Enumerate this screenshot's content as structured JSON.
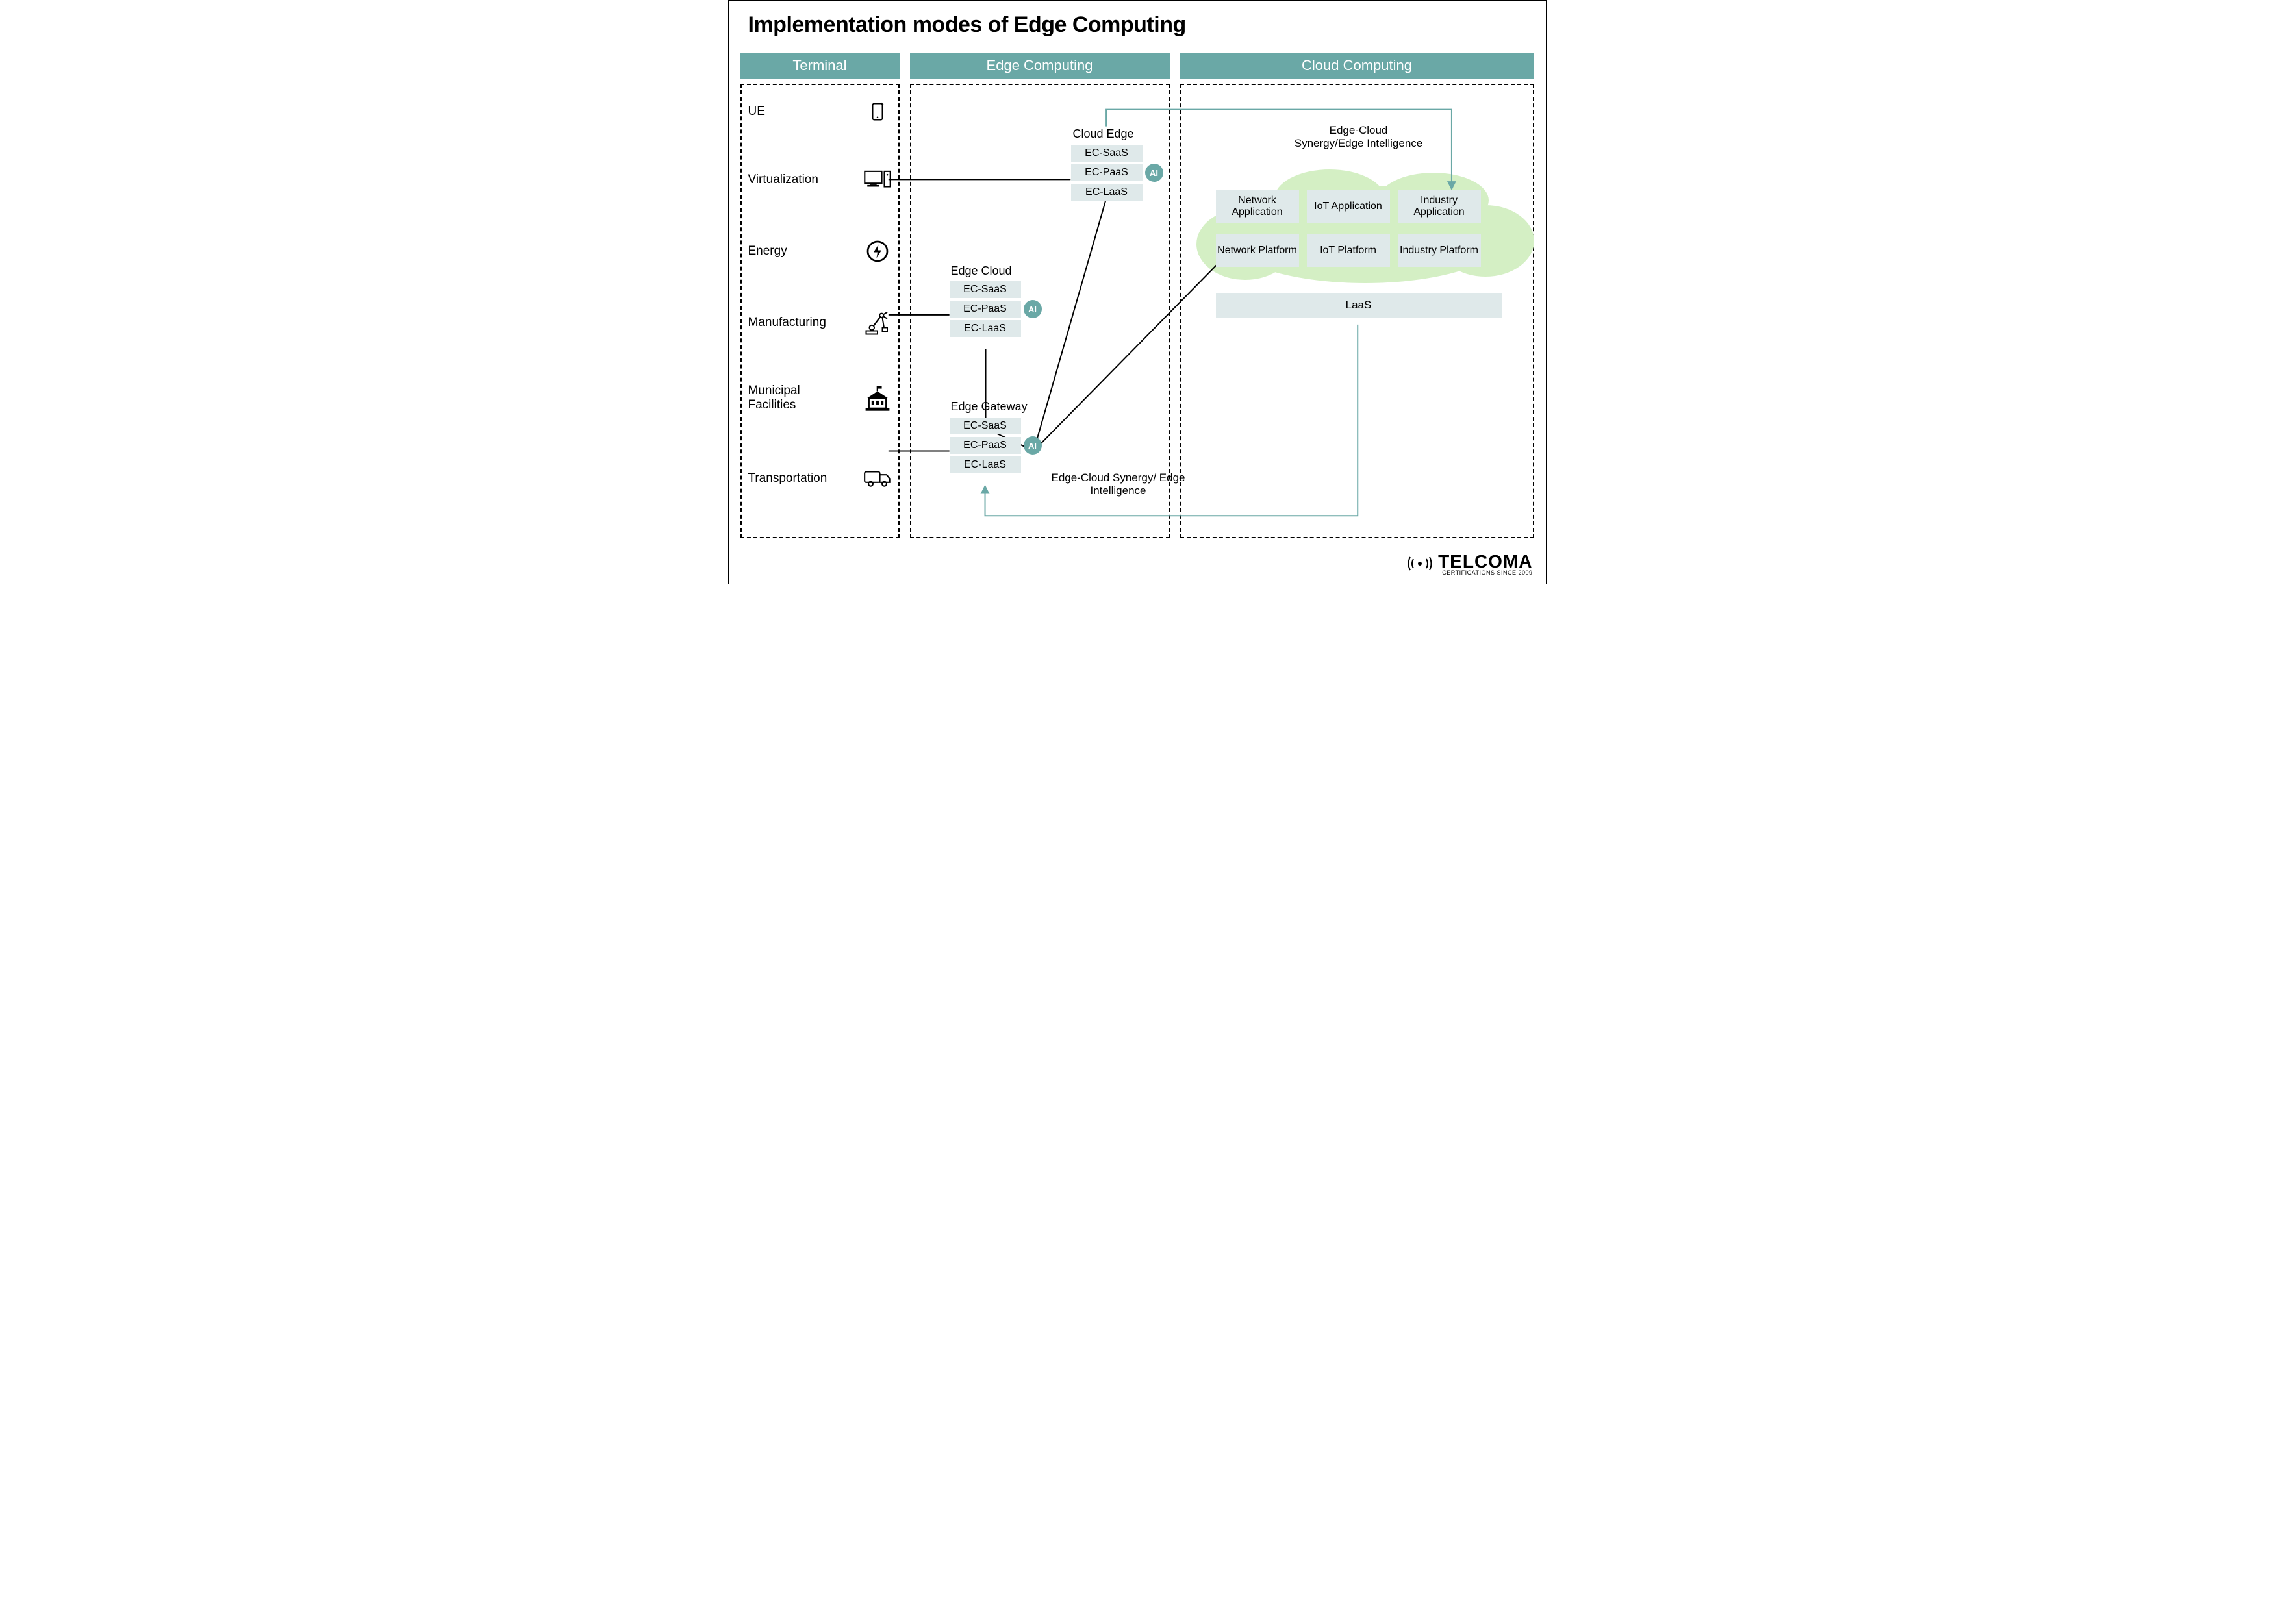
{
  "title": "Implementation modes of Edge Computing",
  "columns": {
    "terminal": "Terminal",
    "edge": "Edge Computing",
    "cloud": "Cloud Computing"
  },
  "terminal_items": [
    {
      "label": "UE",
      "icon": "phone"
    },
    {
      "label": "Virtualization",
      "icon": "desktop"
    },
    {
      "label": "Energy",
      "icon": "bolt"
    },
    {
      "label": "Manufacturing",
      "icon": "robot-arm"
    },
    {
      "label": "Municipal Facilities",
      "icon": "building"
    },
    {
      "label": "Transportation",
      "icon": "truck"
    }
  ],
  "edge_stacks": {
    "cloud_edge": {
      "title": "Cloud Edge",
      "layers": [
        "EC-SaaS",
        "EC-PaaS",
        "EC-LaaS"
      ],
      "ai": "AI"
    },
    "edge_cloud": {
      "title": "Edge Cloud",
      "layers": [
        "EC-SaaS",
        "EC-PaaS",
        "EC-LaaS"
      ],
      "ai": "AI"
    },
    "edge_gateway": {
      "title": "Edge Gateway",
      "layers": [
        "EC-SaaS",
        "EC-PaaS",
        "EC-LaaS"
      ],
      "ai": "AI"
    }
  },
  "cloud_boxes": {
    "row1": [
      "Network Application",
      "IoT Application",
      "Industry Application"
    ],
    "row2": [
      "Network Platform",
      "IoT Platform",
      "Industry Platform"
    ],
    "laas": "LaaS"
  },
  "arrow_labels": {
    "top": "Edge-Cloud Synergy/Edge Intelligence",
    "bottom": "Edge-Cloud Synergy/ Edge Intelligence"
  },
  "brand": {
    "name": "TELCOMA",
    "sub": "CERTIFICATIONS SINCE 2009"
  }
}
